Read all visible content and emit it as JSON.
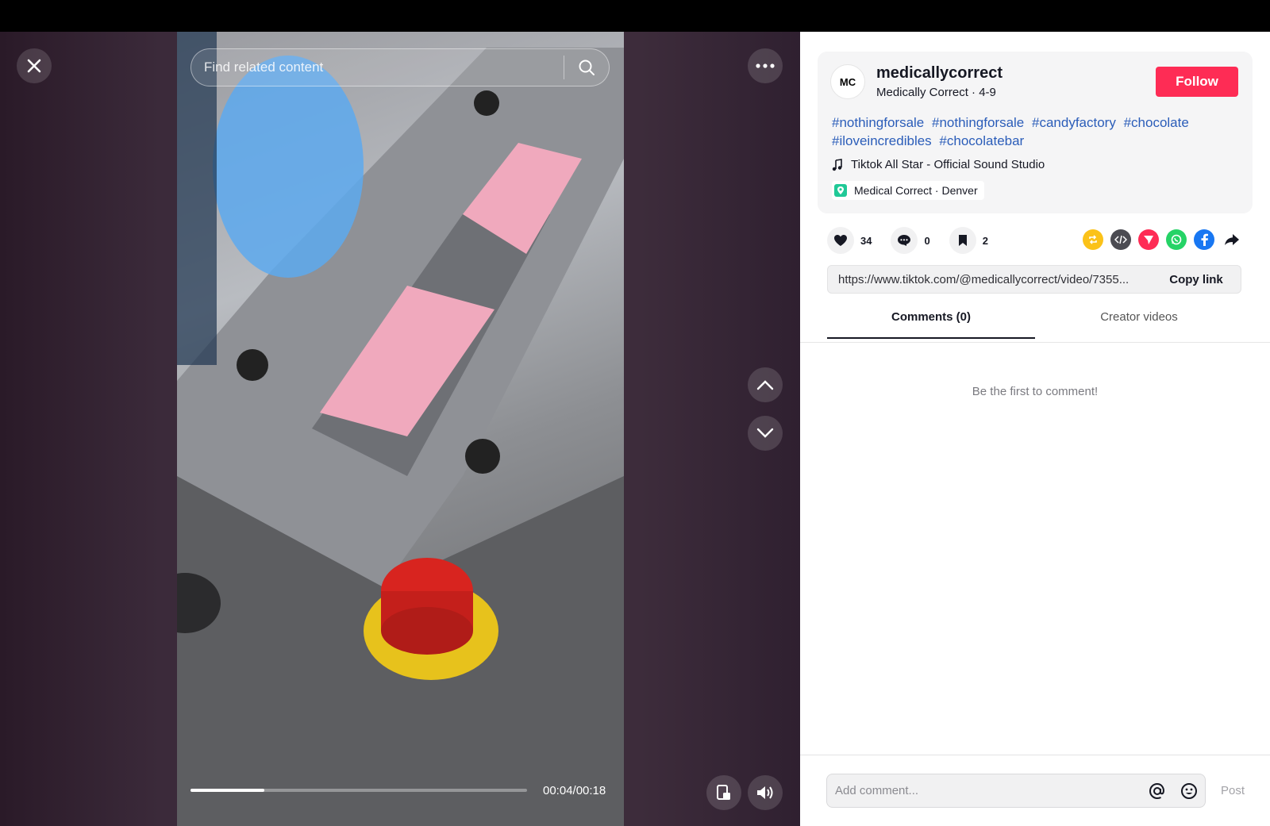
{
  "search": {
    "placeholder": "Find related content"
  },
  "player": {
    "time": "00:04/00:18",
    "progress_fraction": 0.22
  },
  "author": {
    "avatar_text": "MC",
    "username": "medicallycorrect",
    "display_line": "Medically Correct · 4-9",
    "follow_label": "Follow"
  },
  "post": {
    "hashtags": [
      "#nothingforsale",
      "#nothingforsale",
      "#candyfactory",
      "#chocolate",
      "#iloveincredibles",
      "#chocolatebar"
    ],
    "music": "Tiktok All Star - Official Sound Studio",
    "location": "Medical Correct · Denver"
  },
  "stats": {
    "likes": "34",
    "comments": "0",
    "saves": "2"
  },
  "share": {
    "icons": [
      "repost-icon",
      "embed-icon",
      "send-icon",
      "whatsapp-icon",
      "facebook-icon",
      "share-arrow-icon"
    ],
    "colors": {
      "repost": "#fbc219",
      "embed": "#4b4b52",
      "send": "#fe2c55",
      "whatsapp": "#25d366",
      "facebook": "#1877f2"
    }
  },
  "link": {
    "url": "https://www.tiktok.com/@medicallycorrect/video/7355...",
    "copy_label": "Copy link"
  },
  "tabs": {
    "comments": "Comments (0)",
    "creator": "Creator videos"
  },
  "comments": {
    "empty_text": "Be the first to comment!",
    "input_placeholder": "Add comment...",
    "post_label": "Post"
  },
  "colors": {
    "accent": "#fe2c55",
    "hashtag": "#2b5db9"
  }
}
